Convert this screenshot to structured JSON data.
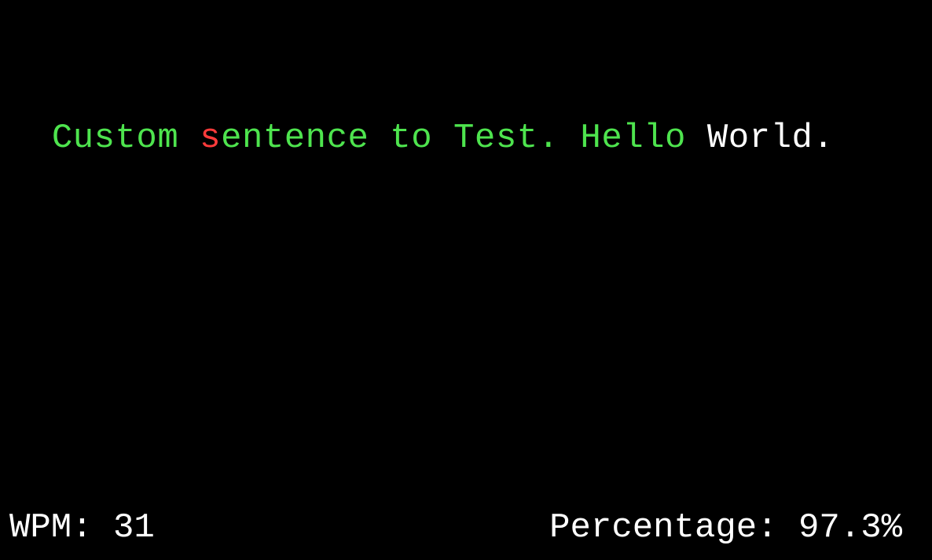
{
  "colors": {
    "background": "#000000",
    "correct": "#4ee44e",
    "incorrect": "#ff3b3b",
    "pending": "#ffffff"
  },
  "sentence": {
    "segments": [
      {
        "text": "Custom ",
        "state": "correct"
      },
      {
        "text": "s",
        "state": "incorrect"
      },
      {
        "text": "entence to Test. Hello ",
        "state": "correct"
      },
      {
        "text": "World.",
        "state": "pending"
      }
    ]
  },
  "stats": {
    "wpm": "WPM: 31",
    "percentage": "Percentage: 97.3%"
  }
}
